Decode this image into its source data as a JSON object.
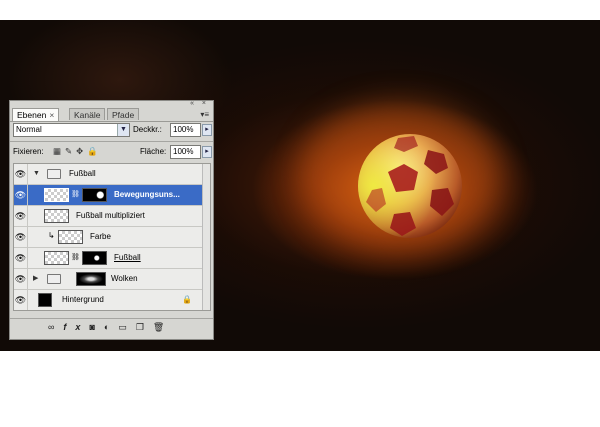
{
  "tabs": [
    {
      "label": "Ebenen",
      "close": "×",
      "active": true
    },
    {
      "label": "Kanäle",
      "active": false
    },
    {
      "label": "Pfade",
      "active": false
    }
  ],
  "panel": {
    "menu_icon": "panel-menu-icon",
    "header_icons": "« ×"
  },
  "blend": {
    "mode": "Normal",
    "opacity_label": "Deckkr.:",
    "opacity": "100%"
  },
  "fix": {
    "label": "Fixieren:",
    "fill_label": "Fläche:",
    "fill": "100%"
  },
  "layers": [
    {
      "name": "Fußball",
      "kind": "group",
      "expanded": true,
      "visible": true
    },
    {
      "name": "Bewegungsuns...",
      "kind": "layer-mask",
      "selected": true,
      "visible": true
    },
    {
      "name": "Fußball multipliziert",
      "kind": "layer",
      "visible": true
    },
    {
      "name": "Farbe",
      "kind": "clipped",
      "visible": true
    },
    {
      "name": "Fußball",
      "kind": "layer-mask",
      "visible": true
    },
    {
      "name": "Wolken",
      "kind": "group",
      "expanded": false,
      "visible": true
    },
    {
      "name": "Hintergrund",
      "kind": "background",
      "visible": true,
      "locked": true
    }
  ],
  "bottom_icons": [
    "link-icon",
    "fx-icon",
    "mask-icon",
    "adjustment-icon",
    "folder-icon",
    "new-layer-icon",
    "trash-icon"
  ],
  "fx_label": "fx",
  "colors": {
    "selection": "#3a6bc6",
    "panel": "#d6d6d2",
    "ball_yellow": "#d8c830",
    "ball_red": "#a82020"
  }
}
